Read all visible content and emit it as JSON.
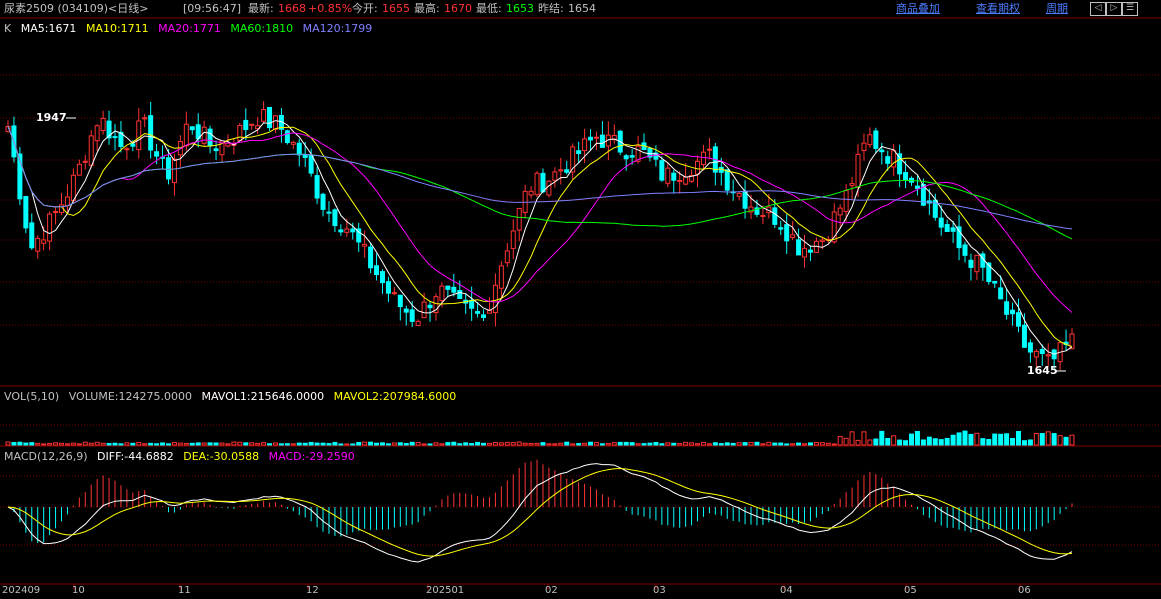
{
  "header": {
    "symbol": "尿素2509 (034109)",
    "period": "<日线>",
    "time": "[09:56:47]",
    "latest_label": "最新:",
    "latest_value": "1668",
    "change": "+0.85%",
    "open_label": "今开:",
    "open_value": "1655",
    "high_label": "最高:",
    "high_value": "1670",
    "low_label": "最低:",
    "low_value": "1653",
    "prev_close_label": "昨结:",
    "prev_close_value": "1654",
    "links": [
      "商品叠加",
      "查看期权",
      "周期"
    ],
    "nav_icons": [
      "prev-icon",
      "next-icon",
      "menu-icon"
    ]
  },
  "price_panel": {
    "prefix": "K",
    "ma5": "MA5:1671",
    "ma10": "MA10:1711",
    "ma20": "MA20:1771",
    "ma60": "MA60:1810",
    "ma120": "MA120:1799",
    "high_marker": "1947",
    "low_marker": "1645"
  },
  "volume_panel": {
    "label": "VOL(5,10)",
    "volume": "VOLUME:124275.0000",
    "mavol1": "MAVOL1:215646.0000",
    "mavol2": "MAVOL2:207984.6000"
  },
  "macd_panel": {
    "label": "MACD(12,26,9)",
    "diff": "DIFF:-44.6882",
    "dea": "DEA:-30.0588",
    "macd": "MACD:-29.2590"
  },
  "x_axis": [
    "202409",
    "10",
    "11",
    "12",
    "202501",
    "02",
    "03",
    "04",
    "05",
    "06"
  ],
  "colors": {
    "up": "#ff3232",
    "down": "#00ffff",
    "ma5": "#ffffff",
    "ma10": "#ffff00",
    "ma20": "#ff00ff",
    "ma60": "#00ff00",
    "ma120": "#8080ff",
    "grid": "#800000"
  },
  "chart_data": {
    "type": "candlestick",
    "x": [
      "2024-09",
      "2024-10",
      "2024-11",
      "2024-12",
      "2025-01",
      "2025-02",
      "2025-03",
      "2025-04",
      "2025-05",
      "2025-06"
    ],
    "close_path": [
      1880,
      1760,
      1790,
      1830,
      1890,
      1860,
      1880,
      1830,
      1885,
      1860,
      1870,
      1890,
      1880,
      1850,
      1800,
      1780,
      1745,
      1710,
      1690,
      1720,
      1700,
      1690,
      1760,
      1820,
      1830,
      1850,
      1870,
      1860,
      1855,
      1830,
      1840,
      1850,
      1820,
      1800,
      1790,
      1760,
      1770,
      1810,
      1870,
      1850,
      1830,
      1790,
      1760,
      1740,
      1700,
      1660,
      1645,
      1668
    ],
    "highest": 1947,
    "lowest": 1645
  }
}
